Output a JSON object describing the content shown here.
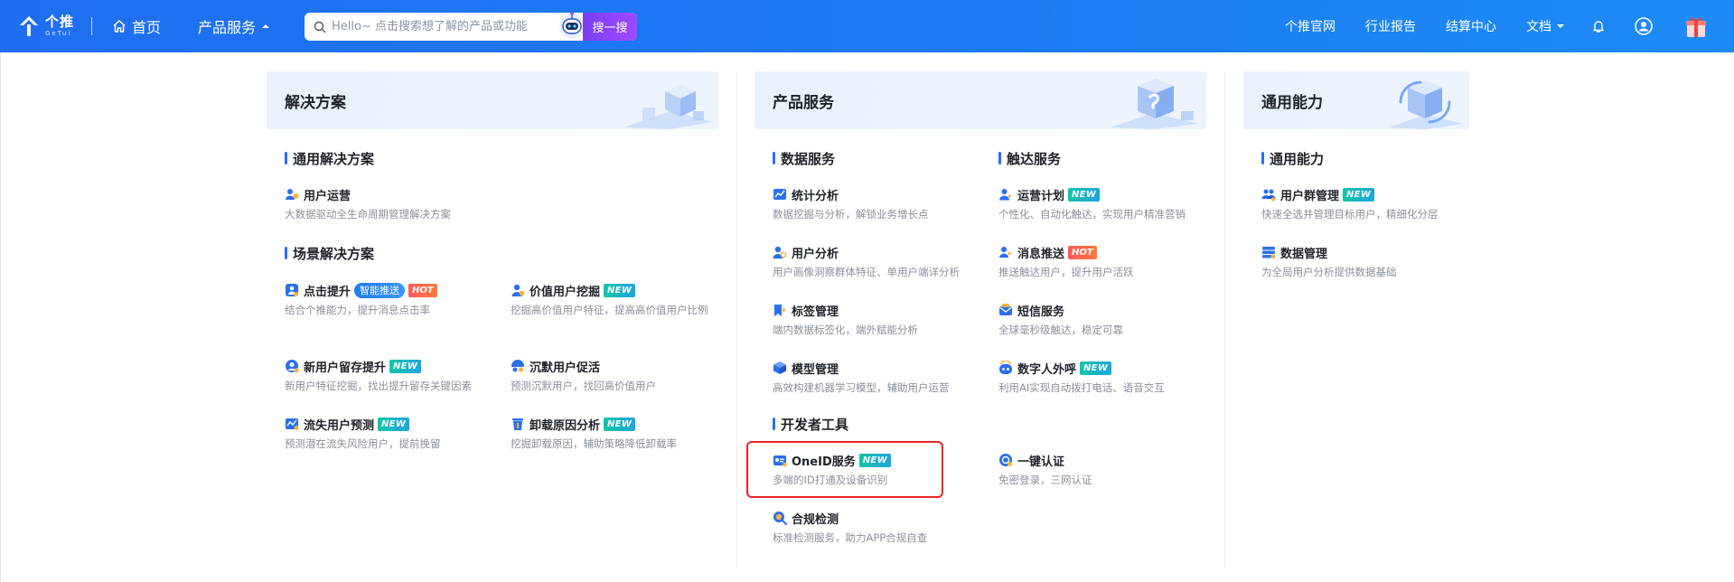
{
  "header": {
    "logo_text": "个推",
    "logo_sub": "GeTui",
    "home_label": "首页",
    "products_label": "产品服务",
    "search": {
      "placeholder": "Hello~ 点击搜索想了解的产品或功能",
      "button_label": "搜一搜"
    },
    "links": {
      "official": "个推官网",
      "reports": "行业报告",
      "billing": "结算中心",
      "docs": "文档"
    }
  },
  "panels": {
    "solutions": {
      "title": "解决方案",
      "section_general": "通用解决方案",
      "section_scene": "场景解决方案",
      "items": {
        "user_ops": {
          "name": "用户运营",
          "desc": "大数据驱动全生命周期管理解决方案"
        },
        "click_boost": {
          "name": "点击提升",
          "tag": "智能推送",
          "badge": "HOT",
          "desc": "结合个推能力，提升消息点击率"
        },
        "value_mining": {
          "name": "价值用户挖掘",
          "badge": "NEW",
          "desc": "挖掘高价值用户特征，提高高价值用户比例"
        },
        "retention": {
          "name": "新用户留存提升",
          "badge": "NEW",
          "desc": "新用户特征挖掘，找出提升留存关键因素"
        },
        "silent": {
          "name": "沉默用户促活",
          "desc": "预测沉默用户，找回高价值用户"
        },
        "churn": {
          "name": "流失用户预测",
          "badge": "NEW",
          "desc": "预测潜在流失风险用户，提前挽留"
        },
        "uninstall": {
          "name": "卸载原因分析",
          "badge": "NEW",
          "desc": "挖掘卸载原因，辅助策略降低卸载率"
        }
      }
    },
    "products": {
      "title": "产品服务",
      "section_data": "数据服务",
      "section_reach": "触达服务",
      "section_dev": "开发者工具",
      "items": {
        "stats": {
          "name": "统计分析",
          "desc": "数据挖掘与分析，解锁业务增长点"
        },
        "user_analysis": {
          "name": "用户分析",
          "desc": "用户画像洞察群体特征、单用户端详分析"
        },
        "tags": {
          "name": "标签管理",
          "desc": "端内数据标签化，端外赋能分析"
        },
        "model": {
          "name": "模型管理",
          "desc": "高效构建机器学习模型，辅助用户运营"
        },
        "ops_plan": {
          "name": "运营计划",
          "badge": "NEW",
          "desc": "个性化、自动化触达，实现用户精准营销"
        },
        "push": {
          "name": "消息推送",
          "badge": "HOT",
          "desc": "推送触达用户，提升用户活跃"
        },
        "sms": {
          "name": "短信服务",
          "desc": "全球毫秒级触达，稳定可靠"
        },
        "digital_call": {
          "name": "数字人外呼",
          "badge": "NEW",
          "desc": "利用AI实现自动拨打电话、语音交互"
        },
        "oneid": {
          "name": "OneID服务",
          "badge": "NEW",
          "desc": "多端的ID打通及设备识别"
        },
        "one_click": {
          "name": "一键认证",
          "desc": "免密登录，三网认证"
        },
        "compliance": {
          "name": "合规检测",
          "desc": "标准检测服务，助力APP合规自查"
        }
      }
    },
    "capabilities": {
      "title": "通用能力",
      "section_general": "通用能力",
      "items": {
        "groups": {
          "name": "用户群管理",
          "badge": "NEW",
          "desc": "快速全选并管理目标用户，精细化分层"
        },
        "data_mgmt": {
          "name": "数据管理",
          "desc": "为全局用户分析提供数据基础"
        }
      }
    }
  },
  "colors": {
    "brand": "#1f6ef0",
    "accent_new": "#12c5a8",
    "accent_hot": "#ff5a5a",
    "highlight": "#e5252a"
  }
}
